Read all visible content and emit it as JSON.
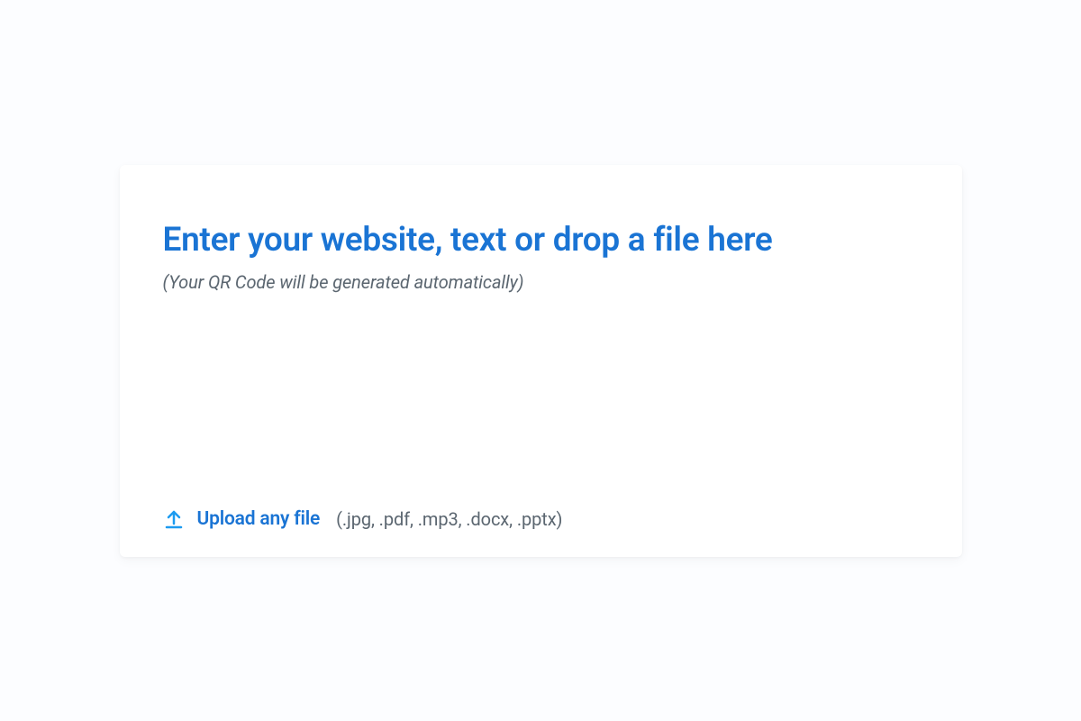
{
  "dropzone": {
    "placeholder_main": "Enter your website, text or drop a file here",
    "placeholder_sub": "(Your QR Code will be generated automatically)"
  },
  "upload": {
    "label": "Upload any file",
    "hint": "(.jpg, .pdf, .mp3, .docx, .pptx)"
  }
}
